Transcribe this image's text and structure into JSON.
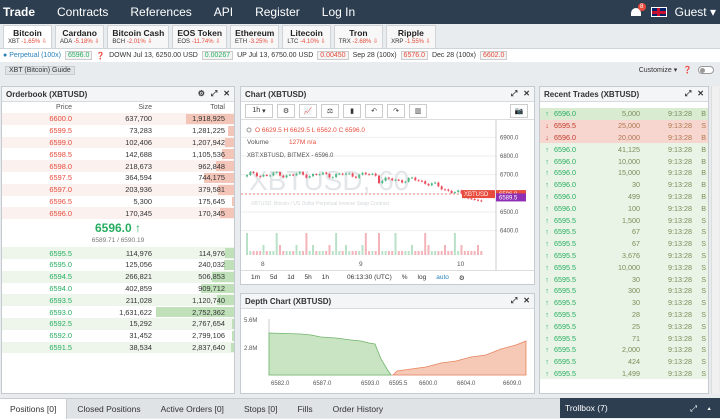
{
  "nav": {
    "logo": "Trade",
    "items": [
      "Contracts",
      "References",
      "API",
      "Register",
      "Log In"
    ],
    "guest": "Guest",
    "notif": "8"
  },
  "tabs": [
    {
      "name": "Bitcoin",
      "sym": "XBT",
      "chg": "-1.65%"
    },
    {
      "name": "Cardano",
      "sym": "ADA",
      "chg": "-5.18%"
    },
    {
      "name": "Bitcoin Cash",
      "sym": "BCH",
      "chg": "-2.01%"
    },
    {
      "name": "EOS Token",
      "sym": "EOS",
      "chg": "-11.74%"
    },
    {
      "name": "Ethereum",
      "sym": "ETH",
      "chg": "-3.25%"
    },
    {
      "name": "Litecoin",
      "sym": "LTC",
      "chg": "-4.10%"
    },
    {
      "name": "Tron",
      "sym": "TRX",
      "chg": "-2.68%"
    },
    {
      "name": "Ripple",
      "sym": "XRP",
      "chg": "-1.55%"
    }
  ],
  "subbar": {
    "perpetual": "Perpetual (100x)",
    "perp_price": "6596.0",
    "down": "DOWN Jul 13, 6250.00 USD",
    "down_val": "0.00267",
    "up": "UP Jul 13, 6750.00 USD",
    "up_val": "0.00450",
    "sep": "Sep 28 (100x)",
    "sep_val": "6576.0",
    "dec": "Dec 28 (100x)",
    "dec_val": "6602.0"
  },
  "guide": "XBT (Bitcoin) Guide",
  "customize": "Customize",
  "orderbook": {
    "title": "Orderbook (XBTUSD)",
    "headers": [
      "Price",
      "Size",
      "Total"
    ],
    "asks": [
      [
        "6600.0",
        "637,700",
        "1,918,925",
        0.62
      ],
      [
        "6599.5",
        "73,283",
        "1,281,225",
        0.08
      ],
      [
        "6599.0",
        "102,406",
        "1,207,942",
        0.11
      ],
      [
        "6598.5",
        "142,688",
        "1,105,536",
        0.15
      ],
      [
        "6598.0",
        "218,673",
        "962,848",
        0.23
      ],
      [
        "6597.5",
        "364,594",
        "744,175",
        0.38
      ],
      [
        "6597.0",
        "203,936",
        "379,581",
        0.21
      ],
      [
        "6596.5",
        "5,300",
        "175,645",
        0.01
      ],
      [
        "6596.0",
        "170,345",
        "170,345",
        0.18
      ]
    ],
    "mid": "6596.0 ↑",
    "mid_sub": "6589.71 / 6590.19",
    "bids": [
      [
        "6595.5",
        "114,976",
        "114,976",
        0.12
      ],
      [
        "6595.0",
        "125,056",
        "240,032",
        0.13
      ],
      [
        "6594.5",
        "266,821",
        "506,853",
        0.28
      ],
      [
        "6594.0",
        "402,859",
        "909,712",
        0.42
      ],
      [
        "6593.5",
        "211,028",
        "1,120,740",
        0.22
      ],
      [
        "6593.0",
        "1,631,622",
        "2,752,362",
        1.0
      ],
      [
        "6592.5",
        "15,292",
        "2,767,654",
        0.02
      ],
      [
        "6592.0",
        "31,452",
        "2,799,106",
        0.03
      ],
      [
        "6591.5",
        "38,534",
        "2,837,640",
        0.04
      ]
    ]
  },
  "chart": {
    "title": "Chart (XBTUSD)",
    "interval": "1h",
    "ohlc": "O 6629.5 H 6629.5 L 6562.0 C 6596.0",
    "volume": "Volume",
    "vol_val": "127M n/a",
    "series": "XBT:XBTUSD, BITMEX - 6596.0",
    "watermark": "XBTUSD, 60",
    "desc": "XBTUSD: Bitcoin / US Dollar Perpetual Inverse Swap Contract",
    "ticks": [
      "6900.0",
      "6800.0",
      "6700.0",
      "6600.0",
      "6500.0",
      "6400.0"
    ],
    "xticks": [
      "8",
      "9",
      "10"
    ],
    "tag1": "XBTUSD",
    "tag1v": "6596.0",
    "tag2": "6589.5",
    "ranges": [
      "1m",
      "5d",
      "1d",
      "5h",
      "1h"
    ],
    "time": "06:13:30 (UTC)",
    "pct": "%",
    "log": "log",
    "auto": "auto"
  },
  "depth": {
    "title": "Depth Chart (XBTUSD)",
    "ylabels": [
      "5.6M",
      "2.8M"
    ],
    "xlabels": [
      "6582.0",
      "6587.0",
      "6593.0",
      "6595.5",
      "6600.0",
      "6604.0",
      "6609.0"
    ]
  },
  "trades": {
    "title": "Recent Trades (XBTUSD)",
    "rows": [
      [
        "up",
        "6596.0",
        "5,000",
        "9:13:28",
        "B"
      ],
      [
        "dn",
        "6595.5",
        "25,000",
        "9:13:28",
        "S"
      ],
      [
        "dn",
        "6596.0",
        "20,000",
        "9:13:28",
        "B"
      ],
      [
        "up",
        "6596.0",
        "41,125",
        "9:13:28",
        "B"
      ],
      [
        "up",
        "6596.0",
        "10,000",
        "9:13:28",
        "B"
      ],
      [
        "up",
        "6596.0",
        "15,000",
        "9:13:28",
        "B"
      ],
      [
        "up",
        "6596.0",
        "30",
        "9:13:28",
        "B"
      ],
      [
        "up",
        "6596.0",
        "499",
        "9:13:28",
        "B"
      ],
      [
        "up",
        "6596.0",
        "100",
        "9:13:28",
        "B"
      ],
      [
        "up",
        "6595.5",
        "1,500",
        "9:13:28",
        "S"
      ],
      [
        "up",
        "6595.5",
        "67",
        "9:13:28",
        "S"
      ],
      [
        "up",
        "6595.5",
        "67",
        "9:13:28",
        "S"
      ],
      [
        "up",
        "6595.5",
        "3,676",
        "9:13:28",
        "S"
      ],
      [
        "up",
        "6595.5",
        "10,000",
        "9:13:28",
        "S"
      ],
      [
        "up",
        "6595.5",
        "30",
        "9:13:28",
        "S"
      ],
      [
        "up",
        "6595.5",
        "300",
        "9:13:28",
        "S"
      ],
      [
        "up",
        "6595.5",
        "30",
        "9:13:28",
        "S"
      ],
      [
        "up",
        "6595.5",
        "28",
        "9:13:28",
        "S"
      ],
      [
        "up",
        "6595.5",
        "25",
        "9:13:28",
        "S"
      ],
      [
        "up",
        "6595.5",
        "71",
        "9:13:28",
        "S"
      ],
      [
        "up",
        "6595.5",
        "2,000",
        "9:13:28",
        "S"
      ],
      [
        "up",
        "6595.5",
        "424",
        "9:13:28",
        "S"
      ],
      [
        "up",
        "6595.5",
        "1,499",
        "9:13:28",
        "S"
      ]
    ]
  },
  "bottom": {
    "tabs": [
      "Positions [0]",
      "Closed Positions",
      "Active Orders [0]",
      "Stops [0]",
      "Fills",
      "Order History"
    ],
    "trollbox": "Trollbox (7)"
  }
}
